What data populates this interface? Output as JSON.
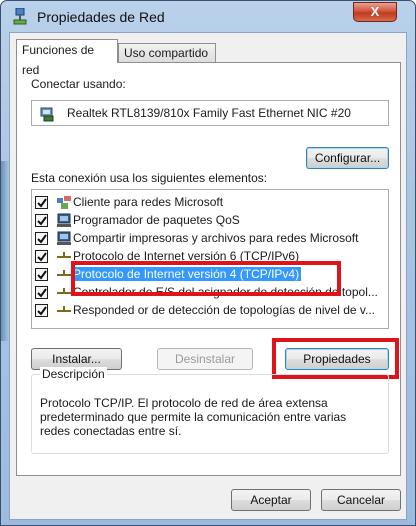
{
  "window": {
    "title": "Propiedades de Red",
    "close_label": "X"
  },
  "tabs": [
    {
      "label": "Funciones de red",
      "active": true
    },
    {
      "label": "Uso compartido",
      "active": false
    }
  ],
  "connect": {
    "label": "Conectar usando:",
    "adapter": "Realtek RTL8139/810x Family Fast Ethernet NIC #20",
    "configure_button": "Configurar..."
  },
  "elements": {
    "label": "Esta conexión usa los siguientes elementos:",
    "items": [
      {
        "label": "Cliente para redes Microsoft",
        "checked": true,
        "icon": "network-client-icon"
      },
      {
        "label": "Programador de paquetes QoS",
        "checked": true,
        "icon": "service-icon"
      },
      {
        "label": "Compartir impresoras y archivos para redes Microsoft",
        "checked": true,
        "icon": "service-icon"
      },
      {
        "label": "Protocolo de Internet versión 6 (TCP/IPv6)",
        "checked": true,
        "icon": "protocol-icon"
      },
      {
        "label": "Protocolo de Internet versión 4 (TCP/IPv4)",
        "checked": true,
        "icon": "protocol-icon",
        "selected": true
      },
      {
        "label": "Controlador de E/S del asignador de detección de topol...",
        "checked": true,
        "icon": "protocol-icon"
      },
      {
        "label": "Responded or de detección de topologías de nivel de v...",
        "checked": true,
        "icon": "protocol-icon"
      }
    ]
  },
  "buttons": {
    "install": "Instalar...",
    "uninstall": "Desinstalar",
    "properties": "Propiedades",
    "ok": "Aceptar",
    "cancel": "Cancelar"
  },
  "description": {
    "title": "Descripción",
    "text": "Protocolo TCP/IP. El protocolo de red de área extensa predeterminado que permite la comunicación entre varias redes conectadas entre sí."
  },
  "colors": {
    "selection": "#3399ff",
    "highlight_box": "#e0121a",
    "titlebar": "#b9d1ea"
  }
}
